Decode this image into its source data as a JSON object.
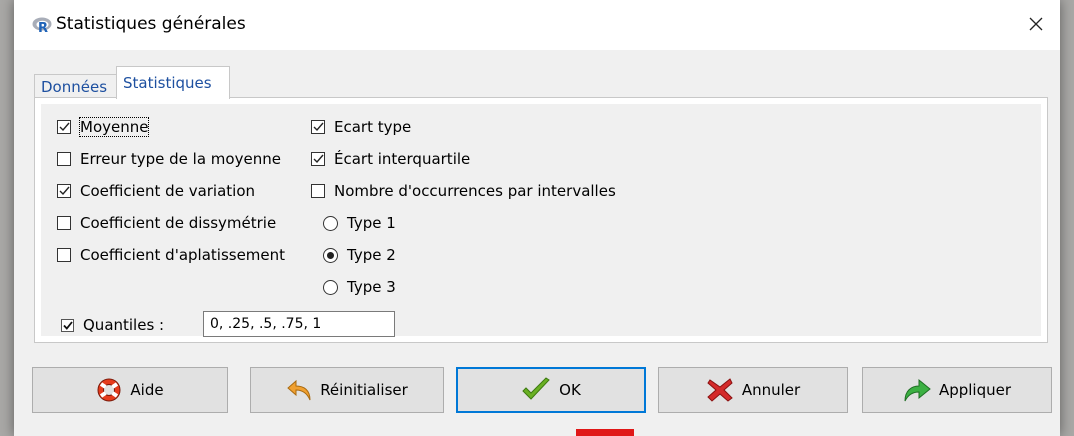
{
  "window": {
    "title": "Statistiques générales",
    "app_icon": "r-logo-icon",
    "close_icon": "close-icon"
  },
  "tabs": [
    {
      "label": "Données",
      "active": false
    },
    {
      "label": "Statistiques",
      "active": true
    }
  ],
  "left_options": [
    {
      "label": "Moyenne",
      "checked": true
    },
    {
      "label": "Erreur type de la moyenne",
      "checked": false
    },
    {
      "label": "Coefficient de variation",
      "checked": true
    },
    {
      "label": "Coefficient de dissymétrie",
      "checked": false
    },
    {
      "label": "Coefficient d'aplatissement",
      "checked": false
    }
  ],
  "right_options": [
    {
      "label": "Ecart type",
      "checked": true
    },
    {
      "label": "Écart interquartile",
      "checked": true
    },
    {
      "label": "Nombre d'occurrences par intervalles",
      "checked": false
    }
  ],
  "type_radios": [
    {
      "label": "Type 1",
      "selected": false
    },
    {
      "label": "Type 2",
      "selected": true
    },
    {
      "label": "Type 3",
      "selected": false
    }
  ],
  "quantiles": {
    "label": "Quantiles :",
    "checked": true,
    "value": "0, .25, .5, .75, 1"
  },
  "buttons": {
    "help": {
      "label": "Aide",
      "icon": "lifebuoy-icon"
    },
    "reset": {
      "label": "Réinitialiser",
      "icon": "undo-arrow-icon"
    },
    "ok": {
      "label": "OK",
      "icon": "checkmark-icon"
    },
    "cancel": {
      "label": "Annuler",
      "icon": "red-x-icon"
    },
    "apply": {
      "label": "Appliquer",
      "icon": "green-arrow-icon"
    }
  },
  "colors": {
    "tab_text": "#1e50a0",
    "default_button_border": "#0078d7",
    "checkmark_green": "#6ab023",
    "cancel_red": "#d42a2a",
    "apply_green": "#3cb043"
  }
}
